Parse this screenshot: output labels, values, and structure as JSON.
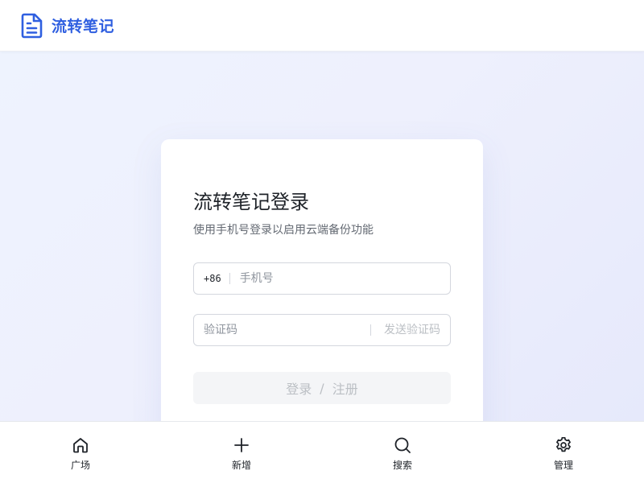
{
  "header": {
    "logo_icon": "document-icon",
    "app_name": "流转笔记",
    "brand_color": "#2f5fe0"
  },
  "login_card": {
    "title": "流转笔记登录",
    "subtitle": "使用手机号登录以启用云端备份功能",
    "phone": {
      "country_code": "+86",
      "placeholder": "手机号",
      "value": ""
    },
    "verification": {
      "placeholder": "验证码",
      "value": "",
      "send_code_label": "发送验证码"
    },
    "submit": {
      "login_label": "登录",
      "separator": "/",
      "register_label": "注册",
      "state": "disabled"
    }
  },
  "bottom_nav": {
    "items": [
      {
        "icon": "home-icon",
        "label": "广场"
      },
      {
        "icon": "plus-icon",
        "label": "新增"
      },
      {
        "icon": "search-icon",
        "label": "搜索"
      },
      {
        "icon": "gear-icon",
        "label": "管理"
      }
    ]
  }
}
